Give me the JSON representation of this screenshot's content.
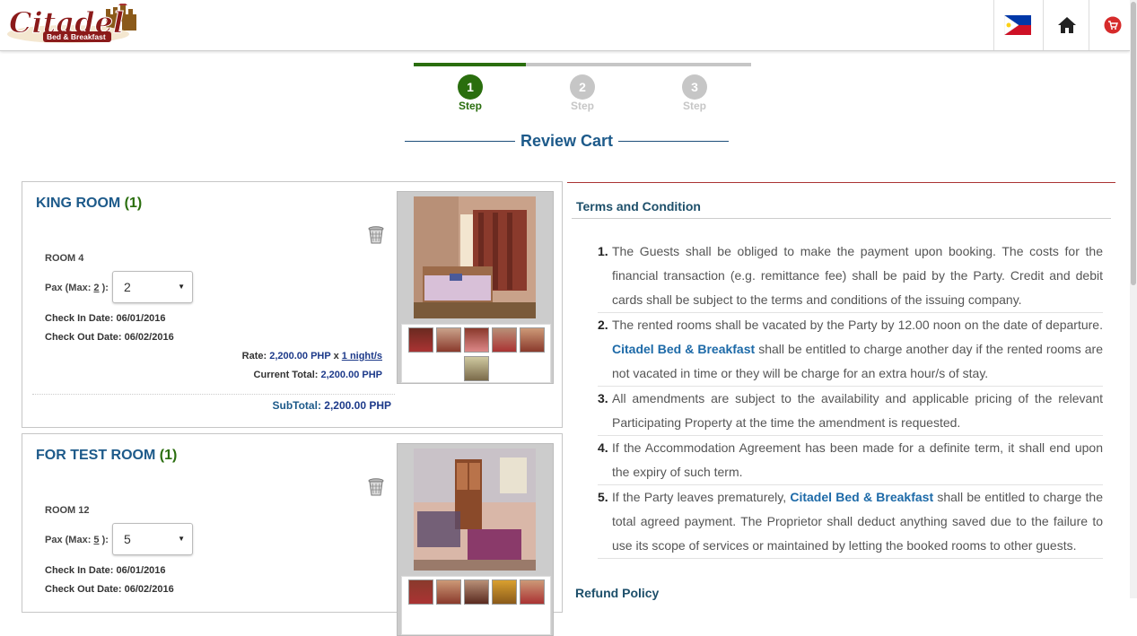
{
  "header": {
    "logo_main": "Citadel",
    "logo_sub": "Bed & Breakfast"
  },
  "steps": [
    {
      "number": "1",
      "label": "Step",
      "state": "active"
    },
    {
      "number": "2",
      "label": "Step",
      "state": "inactive"
    },
    {
      "number": "3",
      "label": "Step",
      "state": "inactive"
    }
  ],
  "page_title": "Review Cart",
  "rooms": [
    {
      "name": "KING ROOM",
      "count": "(1)",
      "room_no": "ROOM 4",
      "pax_label_pre": "Pax (Max: ",
      "pax_max": "2",
      "pax_label_post": " ):",
      "pax_value": "2",
      "check_in_label": "Check In Date:",
      "check_in": "06/01/2016",
      "check_out_label": "Check Out Date:",
      "check_out": "06/02/2016",
      "rate_label": "Rate:",
      "rate_value": "2,200.00 PHP",
      "rate_x": "x",
      "nights": "1 night/s",
      "current_total_label": "Current Total:",
      "current_total": "2,200.00 PHP",
      "subtotal_label": "SubTotal:",
      "subtotal": "2,200.00 PHP"
    },
    {
      "name": "FOR TEST ROOM",
      "count": "(1)",
      "room_no": "ROOM 12",
      "pax_label_pre": "Pax (Max: ",
      "pax_max": "5",
      "pax_label_post": " ):",
      "pax_value": "5",
      "check_in_label": "Check In Date:",
      "check_in": "06/01/2016",
      "check_out_label": "Check Out Date:",
      "check_out": "06/02/2016"
    }
  ],
  "terms": {
    "title": "Terms and Condition",
    "items": [
      {
        "n": "1.",
        "text": "The Guests shall be obliged to make the payment upon booking. The costs for the financial transaction (e.g. remittance fee) shall be paid by the Party. Credit and debit cards shall be subject to the terms and conditions of the issuing company."
      },
      {
        "n": "2.",
        "pre": "The rented rooms shall be vacated by the Party by 12.00 noon on the date of departure. ",
        "brand": "Citadel Bed & Breakfast",
        "post": " shall be entitled to charge another day if the rented rooms are not vacated in time or they will be charge for an extra hour/s of stay."
      },
      {
        "n": "3.",
        "text": "All amendments are subject to the availability and applicable pricing of the relevant Participating Property at the time the amendment is requested."
      },
      {
        "n": "4.",
        "text": "If the Accommodation Agreement has been made for a definite term, it shall end upon the expiry of such term."
      },
      {
        "n": "5.",
        "pre": "If the Party leaves prematurely, ",
        "brand": "Citadel Bed & Breakfast",
        "post": " shall be entitled to charge the total agreed payment. The Proprietor shall deduct anything saved due to the failure to use its scope of services or maintained by letting the booked rooms to other guests."
      }
    ],
    "refund_title": "Refund Policy"
  },
  "colors": {
    "brand_blue": "#1d5a8a",
    "step_green": "#2a6e0e",
    "logo_red": "#8b1a1a"
  }
}
